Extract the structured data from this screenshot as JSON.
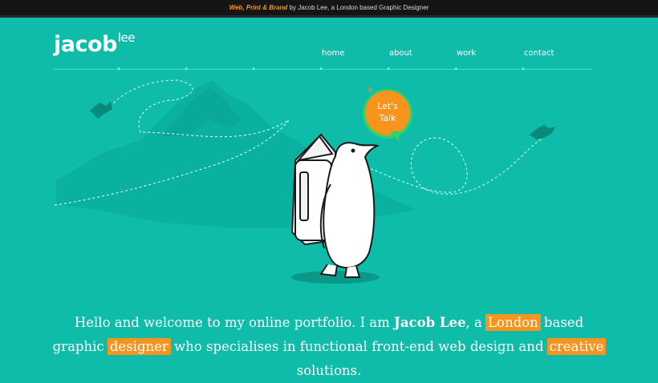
{
  "topbar": {
    "accent": "Web, Print & Brand",
    "rest": " by Jacob Lee, a London based Graphic Designer"
  },
  "logo": {
    "main": "jacob",
    "sup": "lee"
  },
  "nav": [
    {
      "label": "home"
    },
    {
      "label": "about"
    },
    {
      "label": "work"
    },
    {
      "label": "contact"
    }
  ],
  "bubble": {
    "line1": "Let's",
    "line2": "Talk"
  },
  "intro": {
    "part1": "Hello and welcome to my online portfolio. I am ",
    "name": "Jacob Lee",
    "part2": ", a ",
    "hl1": "London",
    "part3": " based graphic ",
    "hl2": "designer",
    "part4": " who specialises in functional front-end web design and ",
    "hl3": "creative",
    "part5": " solutions."
  },
  "colors": {
    "background": "#0fbcaa",
    "accent": "#f7941d",
    "topbar": "#151515"
  },
  "icons": [
    "bird-icon",
    "bird-icon",
    "penguin-illustration",
    "mountain-illustration",
    "speech-bubble-icon"
  ]
}
